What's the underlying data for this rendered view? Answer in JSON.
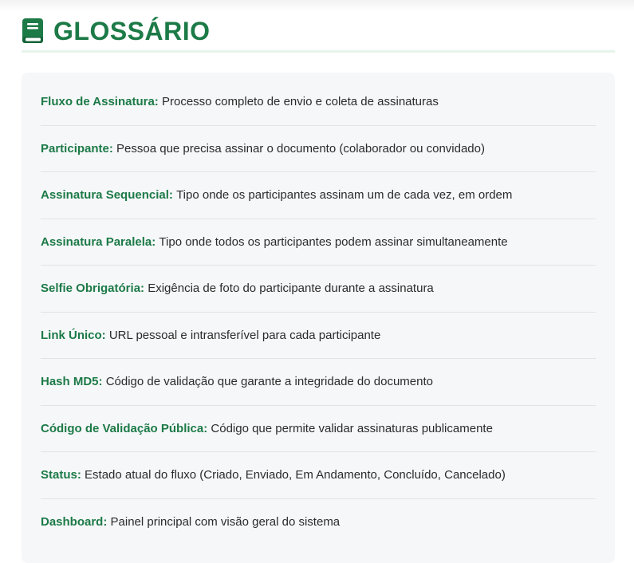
{
  "header": {
    "title": "GLOSSÁRIO",
    "icon": "book-icon",
    "accent_color": "#1c7a47"
  },
  "glossary": {
    "items": [
      {
        "term": "Fluxo de Assinatura:",
        "definition": "Processo completo de envio e coleta de assinaturas"
      },
      {
        "term": "Participante:",
        "definition": "Pessoa que precisa assinar o documento (colaborador ou convidado)"
      },
      {
        "term": "Assinatura Sequencial:",
        "definition": "Tipo onde os participantes assinam um de cada vez, em ordem"
      },
      {
        "term": "Assinatura Paralela:",
        "definition": "Tipo onde todos os participantes podem assinar simultaneamente"
      },
      {
        "term": "Selfie Obrigatória:",
        "definition": "Exigência de foto do participante durante a assinatura"
      },
      {
        "term": "Link Único:",
        "definition": "URL pessoal e intransferível para cada participante"
      },
      {
        "term": "Hash MD5:",
        "definition": "Código de validação que garante a integridade do documento"
      },
      {
        "term": "Código de Validação Pública:",
        "definition": "Código que permite validar assinaturas publicamente"
      },
      {
        "term": "Status:",
        "definition": "Estado atual do fluxo (Criado, Enviado, Em Andamento, Concluído, Cancelado)"
      },
      {
        "term": "Dashboard:",
        "definition": "Painel principal com visão geral do sistema"
      }
    ]
  }
}
